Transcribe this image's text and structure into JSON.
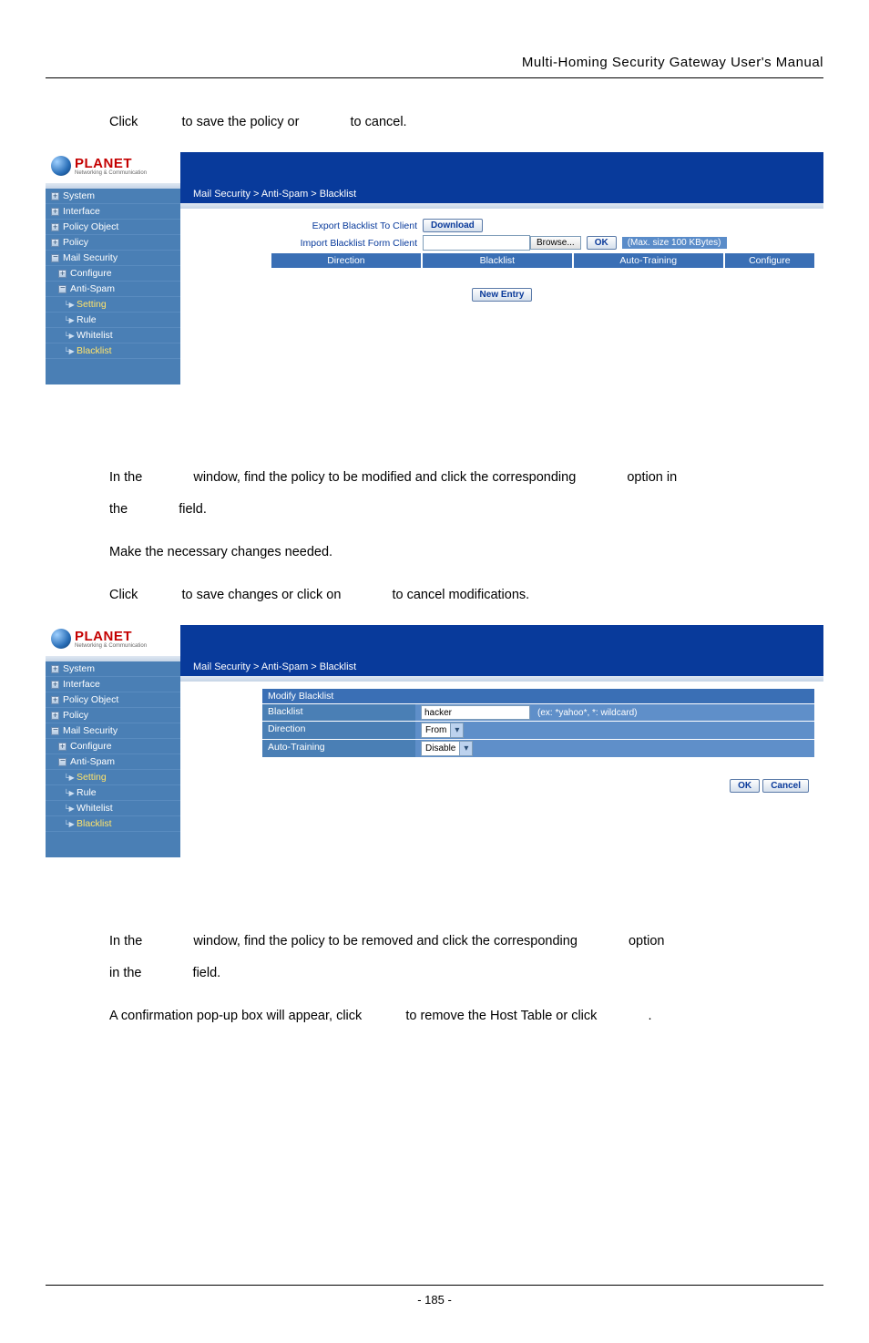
{
  "doc": {
    "title": "Multi-Homing Security Gateway User's Manual",
    "page_number": "- 185 -"
  },
  "text": {
    "step8_a": "Click",
    "step8_b": "to save the policy or",
    "step8_c": "to cancel.",
    "modify_1a": "In the",
    "modify_1b": "window, find the policy to be modified and click the corresponding",
    "modify_1c": "option in",
    "modify_1d": "the",
    "modify_1e": "field.",
    "modify_2": "Make the necessary changes needed.",
    "modify_3a": "Click",
    "modify_3b": "to save changes or click on",
    "modify_3c": "to cancel modifications.",
    "remove_1a": "In the",
    "remove_1b": "window, find the policy to be removed and click the corresponding",
    "remove_1c": "option",
    "remove_1d": "in the",
    "remove_1e": "field.",
    "remove_2a": "A confirmation pop-up box will appear, click",
    "remove_2b": "to remove the Host Table or click",
    "remove_2c": "."
  },
  "brand": {
    "name": "PLANET",
    "tag": "Networking & Communication"
  },
  "nav": {
    "breadcrumb": "Mail Security > Anti-Spam > Blacklist",
    "items": {
      "system": "System",
      "interface": "Interface",
      "policy_object": "Policy Object",
      "policy": "Policy",
      "mail_security": "Mail Security",
      "configure": "Configure",
      "anti_spam": "Anti-Spam",
      "setting": "Setting",
      "rule": "Rule",
      "whitelist": "Whitelist",
      "blacklist": "Blacklist"
    }
  },
  "screenshot1": {
    "export_label": "Export Blacklist To Client",
    "download": "Download",
    "import_label": "Import Blacklist Form Client",
    "browse": "Browse...",
    "ok": "OK",
    "max_note": "(Max. size 100 KBytes)",
    "th_direction": "Direction",
    "th_blacklist": "Blacklist",
    "th_autotrain": "Auto-Training",
    "th_configure": "Configure",
    "new_entry": "New Entry"
  },
  "screenshot2": {
    "form_title": "Modify Blacklist",
    "row_blacklist": "Blacklist",
    "row_blacklist_val": "hacker",
    "row_blacklist_hint": "(ex: *yahoo*, *: wildcard)",
    "row_direction": "Direction",
    "row_direction_val": "From",
    "row_autotrain": "Auto-Training",
    "row_autotrain_val": "Disable",
    "ok": "OK",
    "cancel": "Cancel"
  }
}
